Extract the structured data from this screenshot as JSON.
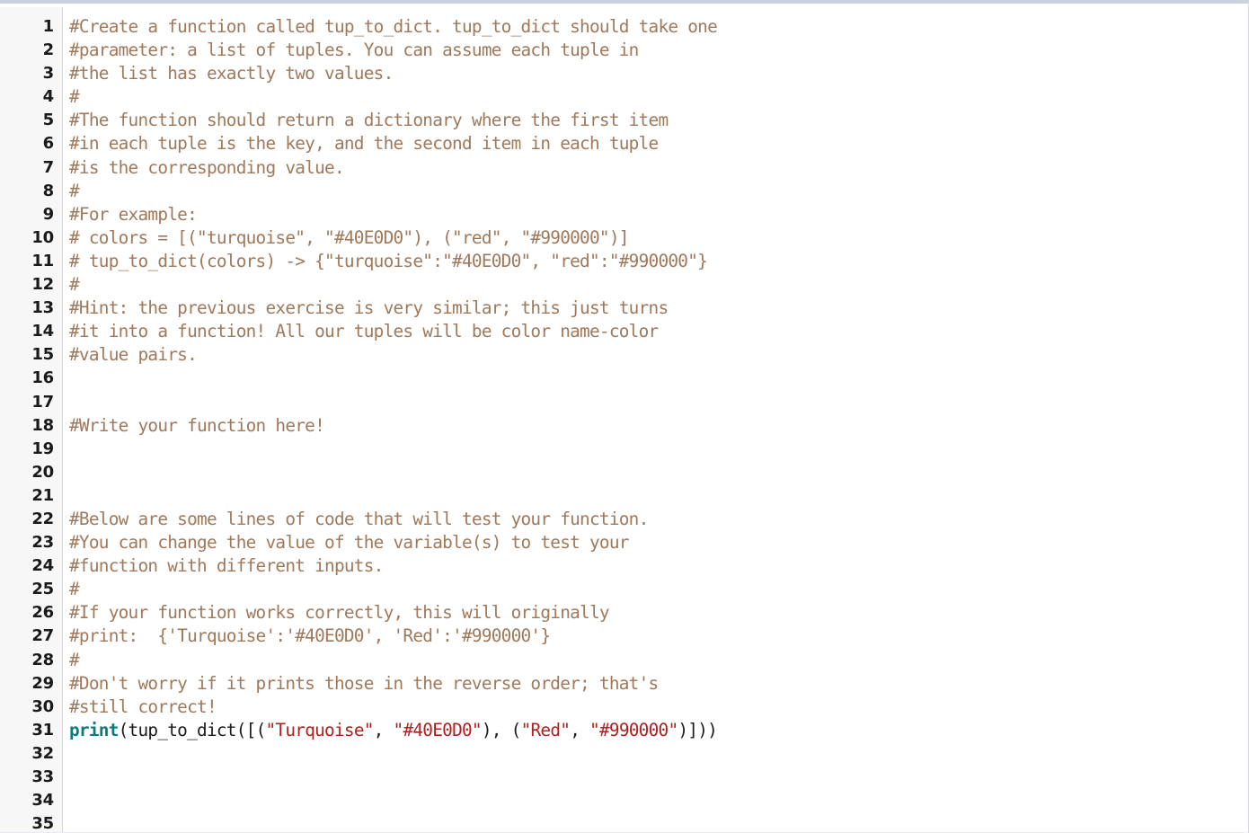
{
  "editor": {
    "name": "python-code-editor",
    "language": "python",
    "first_line_number": 1,
    "last_line_number": 35,
    "total_lines": 35,
    "colors": {
      "background": "#ffffff",
      "gutter_background": "#f7f7f7",
      "gutter_border": "#d7d7d7",
      "top_border": "#ccd2dd",
      "line_number_text": "#1a1a1a",
      "comment": "#a0785a",
      "keyword": "#0e7c7b",
      "string": "#b02020",
      "plain": "#1c1c1c"
    }
  },
  "lines": [
    {
      "number": "1",
      "tokens": [
        {
          "type": "comment",
          "text": "#Create a function called tup_to_dict. tup_to_dict should take one"
        }
      ]
    },
    {
      "number": "2",
      "tokens": [
        {
          "type": "comment",
          "text": "#parameter: a list of tuples. You can assume each tuple in"
        }
      ]
    },
    {
      "number": "3",
      "tokens": [
        {
          "type": "comment",
          "text": "#the list has exactly two values."
        }
      ]
    },
    {
      "number": "4",
      "tokens": [
        {
          "type": "comment",
          "text": "#"
        }
      ]
    },
    {
      "number": "5",
      "tokens": [
        {
          "type": "comment",
          "text": "#The function should return a dictionary where the first item"
        }
      ]
    },
    {
      "number": "6",
      "tokens": [
        {
          "type": "comment",
          "text": "#in each tuple is the key, and the second item in each tuple"
        }
      ]
    },
    {
      "number": "7",
      "tokens": [
        {
          "type": "comment",
          "text": "#is the corresponding value."
        }
      ]
    },
    {
      "number": "8",
      "tokens": [
        {
          "type": "comment",
          "text": "#"
        }
      ]
    },
    {
      "number": "9",
      "tokens": [
        {
          "type": "comment",
          "text": "#For example:"
        }
      ]
    },
    {
      "number": "10",
      "tokens": [
        {
          "type": "comment",
          "text": "# colors = [(\"turquoise\", \"#40E0D0\"), (\"red\", \"#990000\")]"
        }
      ]
    },
    {
      "number": "11",
      "tokens": [
        {
          "type": "comment",
          "text": "# tup_to_dict(colors) -> {\"turquoise\":\"#40E0D0\", \"red\":\"#990000\"}"
        }
      ]
    },
    {
      "number": "12",
      "tokens": [
        {
          "type": "comment",
          "text": "#"
        }
      ]
    },
    {
      "number": "13",
      "tokens": [
        {
          "type": "comment",
          "text": "#Hint: the previous exercise is very similar; this just turns"
        }
      ]
    },
    {
      "number": "14",
      "tokens": [
        {
          "type": "comment",
          "text": "#it into a function! All our tuples will be color name-color"
        }
      ]
    },
    {
      "number": "15",
      "tokens": [
        {
          "type": "comment",
          "text": "#value pairs."
        }
      ]
    },
    {
      "number": "16",
      "tokens": []
    },
    {
      "number": "17",
      "tokens": []
    },
    {
      "number": "18",
      "tokens": [
        {
          "type": "comment",
          "text": "#Write your function here!"
        }
      ]
    },
    {
      "number": "19",
      "tokens": []
    },
    {
      "number": "20",
      "tokens": []
    },
    {
      "number": "21",
      "tokens": []
    },
    {
      "number": "22",
      "tokens": [
        {
          "type": "comment",
          "text": "#Below are some lines of code that will test your function."
        }
      ]
    },
    {
      "number": "23",
      "tokens": [
        {
          "type": "comment",
          "text": "#You can change the value of the variable(s) to test your"
        }
      ]
    },
    {
      "number": "24",
      "tokens": [
        {
          "type": "comment",
          "text": "#function with different inputs."
        }
      ]
    },
    {
      "number": "25",
      "tokens": [
        {
          "type": "comment",
          "text": "#"
        }
      ]
    },
    {
      "number": "26",
      "tokens": [
        {
          "type": "comment",
          "text": "#If your function works correctly, this will originally"
        }
      ]
    },
    {
      "number": "27",
      "tokens": [
        {
          "type": "comment",
          "text": "#print:  {'Turquoise':'#40E0D0', 'Red':'#990000'}"
        }
      ]
    },
    {
      "number": "28",
      "tokens": [
        {
          "type": "comment",
          "text": "#"
        }
      ]
    },
    {
      "number": "29",
      "tokens": [
        {
          "type": "comment",
          "text": "#Don't worry if it prints those in the reverse order; that's"
        }
      ]
    },
    {
      "number": "30",
      "tokens": [
        {
          "type": "comment",
          "text": "#still correct!"
        }
      ]
    },
    {
      "number": "31",
      "tokens": [
        {
          "type": "keyword",
          "text": "print"
        },
        {
          "type": "plain",
          "text": "(tup_to_dict([("
        },
        {
          "type": "string",
          "text": "\"Turquoise\""
        },
        {
          "type": "plain",
          "text": ", "
        },
        {
          "type": "string",
          "text": "\"#40E0D0\""
        },
        {
          "type": "plain",
          "text": "), ("
        },
        {
          "type": "string",
          "text": "\"Red\""
        },
        {
          "type": "plain",
          "text": ", "
        },
        {
          "type": "string",
          "text": "\"#990000\""
        },
        {
          "type": "plain",
          "text": ")]))"
        }
      ]
    },
    {
      "number": "32",
      "tokens": []
    },
    {
      "number": "33",
      "tokens": []
    },
    {
      "number": "34",
      "tokens": []
    },
    {
      "number": "35",
      "tokens": []
    }
  ]
}
